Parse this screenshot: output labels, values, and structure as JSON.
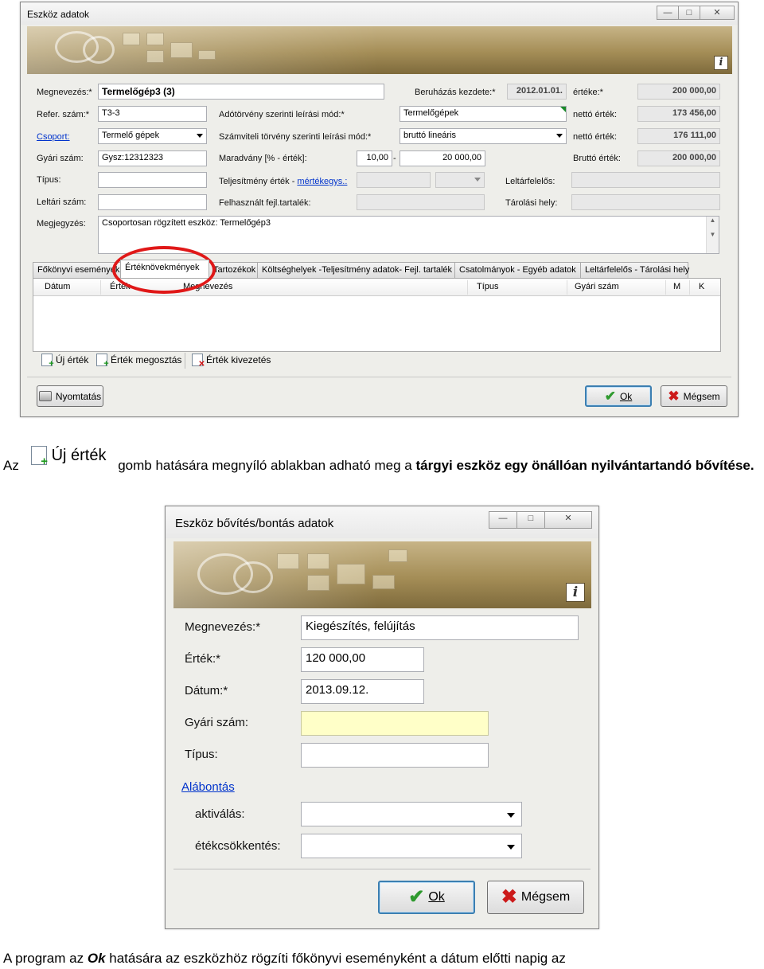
{
  "window1": {
    "title": "Eszköz adatok",
    "fields": {
      "megnevezes": {
        "label": "Megnevezés:*",
        "value": "Termelőgép3 (3)"
      },
      "refer": {
        "label": "Refer. szám:*",
        "value": "T3-3"
      },
      "csoport": {
        "label": "Csoport:",
        "value": "Termelő gépek"
      },
      "gyari": {
        "label": "Gyári szám:",
        "value": "Gysz:12312323"
      },
      "tipus": {
        "label": "Típus:",
        "value": ""
      },
      "leltari": {
        "label": "Leltári szám:",
        "value": ""
      },
      "megjegyzes": {
        "label": "Megjegyzés:",
        "value": "Csoportosan rögzített eszköz: Termelőgép3"
      },
      "beruhazas": {
        "label": "Beruházás kezdete:*",
        "value": "2012.01.01."
      },
      "adotorveny": {
        "label": "Adótörvény szerinti leírási mód:*",
        "value": "Termelőgépek"
      },
      "szamviteli": {
        "label": "Számviteli törvény szerinti leírási mód:*",
        "value": "bruttó lineáris"
      },
      "maradvany": {
        "label": "Maradvány [% - érték]:",
        "value_pct": "10,00",
        "sep": "-",
        "value_amt": "20 000,00"
      },
      "teljesitmeny": {
        "label_prefix": "Teljesítmény érték - ",
        "label_link": "mértékegys.:"
      },
      "felhasznalt": {
        "label": "Felhasznált fejl.tartalék:"
      },
      "erteke": {
        "label": "értéke:*",
        "value": "200 000,00"
      },
      "netto1": {
        "label": "nettó érték:",
        "value": "173 456,00"
      },
      "netto2": {
        "label": "nettó érték:",
        "value": "176 111,00"
      },
      "brutto": {
        "label": "Bruttó érték:",
        "value": "200 000,00"
      },
      "leltarfelelos": {
        "label": "Leltárfelelős:"
      },
      "tarolasi": {
        "label": "Tárolási hely:"
      }
    },
    "tabs": [
      {
        "label": "Főkönyvi események"
      },
      {
        "label": "Értéknövekmények"
      },
      {
        "label": "Tartozékok"
      },
      {
        "label": "Költséghelyek -Teljesítmény adatok- Fejl. tartalék"
      },
      {
        "label": "Csatolmányok - Egyéb adatok"
      },
      {
        "label": "Leltárfelelős - Tárolási hely"
      }
    ],
    "grid_columns": [
      "Dátum",
      "Érték",
      "Megnevezés",
      "Típus",
      "Gyári szám",
      "M",
      "K"
    ],
    "toolbar": {
      "new": "Új érték",
      "share": "Érték megosztás",
      "remove": "Érték kivezetés"
    },
    "buttons": {
      "print": "Nyomtatás",
      "ok": "Ok",
      "cancel": "Mégsem"
    }
  },
  "paragraph1": {
    "prefix": "Az",
    "icon_label": "Új érték",
    "middle": "gomb hatására megnyíló ablakban adható meg a",
    "bold": "tárgyi eszköz egy önállóan nyilvántartandó bővítése."
  },
  "window2": {
    "title": "Eszköz bővítés/bontás adatok",
    "fields": {
      "megnevezes": {
        "label": "Megnevezés:*",
        "value": "Kiegészítés, felújítás"
      },
      "ertek": {
        "label": "Érték:*",
        "value": "120 000,00"
      },
      "datum": {
        "label": "Dátum:*",
        "value": "2013.09.12."
      },
      "gyari": {
        "label": "Gyári szám:",
        "value": ""
      },
      "tipus": {
        "label": "Típus:",
        "value": ""
      },
      "alabontas": {
        "label": "Alábontás"
      },
      "aktivalas": {
        "label": "aktiválás:",
        "value": ""
      },
      "etekcsokkentes": {
        "label": "étékcsökkentés:",
        "value": ""
      }
    },
    "buttons": {
      "ok": "Ok",
      "cancel": "Mégsem"
    }
  },
  "paragraph2": {
    "prefix": "A program az",
    "bold_italic": "Ok",
    "rest": "hatására az eszközhöz rögzíti főkönyvi eseményként a dátum előtti napig az"
  },
  "colors": {
    "banner_gold": "#a48d56",
    "highlight_red": "#e01818",
    "link_blue": "#0033cc",
    "required_yellow": "#ffffc8"
  }
}
